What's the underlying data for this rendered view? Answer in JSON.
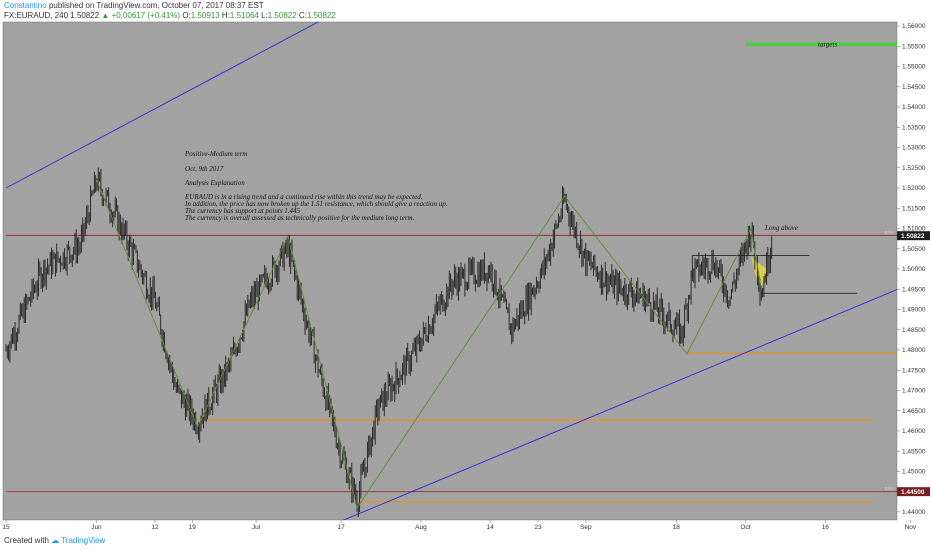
{
  "header": {
    "author": "Constantino",
    "published": "published on TradingView.com, October 07, 2017 08:37 EST",
    "symbol": "FX:EURAUD, 240",
    "last": "1.50822",
    "change": "+0.00617 (+0.41%)",
    "o_label": "O:",
    "o_value": "1.50913",
    "h_label": "H:",
    "h_value": "1.51064",
    "l_label": "L:",
    "l_value": "1.50822",
    "c_label": "C:",
    "c_value": "1.50822"
  },
  "footer": {
    "created_with": "Created with",
    "brand": "TradingView"
  },
  "colors": {
    "background": "#a2a2a2",
    "candle": "#1f1f1f",
    "channel": "#2b2bd6",
    "zigzag": "#5f8a3e",
    "support": "#e0922e",
    "resistance": "#9e2a2a",
    "target": "#55c84a",
    "panel": "#ffffff"
  },
  "annotation": {
    "lines": [
      "Positive-Medium term",
      "Oct, 9th  2017",
      "Analysis Explanation",
      "EURAUD is in a rising trend and a continued rise within this trend may be expected.",
      "In addition, the price has now broken up the 1.51 resistance, which should give a reaction up.",
      "The currency has support at points 1.445",
      "The currency is overall assessed as technically positive for the medium long term."
    ],
    "targets_label": "targets",
    "long_label": "Long above",
    "price_tag_upper": "1.50822",
    "price_tag_lower": "1.44500",
    "small_tag": "ESA"
  },
  "chart_data": {
    "type": "line",
    "title": "",
    "series_name": "",
    "y_ticks": [
      "1.56000",
      "1.55500",
      "1.55000",
      "1.54500",
      "1.54000",
      "1.53500",
      "1.53000",
      "1.52500",
      "1.52000",
      "1.51500",
      "1.51000",
      "1.50500",
      "1.50000",
      "1.49500",
      "1.49000",
      "1.48500",
      "1.48000",
      "1.47500",
      "1.47000",
      "1.46500",
      "1.46000",
      "1.45500",
      "1.45000",
      "1.44500",
      "1.44000"
    ],
    "x_ticks": [
      "15",
      "Jun",
      "12",
      "19",
      "Jul",
      "17",
      "Aug",
      "14",
      "23",
      "Sep",
      "18",
      "Oct",
      "16",
      "Nov",
      "13"
    ],
    "ylim": [
      1.438,
      1.561
    ],
    "price_path": [
      {
        "x": "May 15",
        "y": 1.48
      },
      {
        "x": "May 22",
        "y": 1.5
      },
      {
        "x": "May 29",
        "y": 1.506
      },
      {
        "x": "Jun 1",
        "y": 1.522
      },
      {
        "x": "Jun 5",
        "y": 1.512
      },
      {
        "x": "Jun 12",
        "y": 1.492
      },
      {
        "x": "Jun 16",
        "y": 1.47
      },
      {
        "x": "Jun 20",
        "y": 1.462
      },
      {
        "x": "Jun 26",
        "y": 1.476
      },
      {
        "x": "Jun 30",
        "y": 1.492
      },
      {
        "x": "Jul 7",
        "y": 1.505
      },
      {
        "x": "Jul 13",
        "y": 1.474
      },
      {
        "x": "Jul 17",
        "y": 1.454
      },
      {
        "x": "Jul 20",
        "y": 1.443
      },
      {
        "x": "Jul 24",
        "y": 1.466
      },
      {
        "x": "Jul 31",
        "y": 1.48
      },
      {
        "x": "Aug 7",
        "y": 1.497
      },
      {
        "x": "Aug 14",
        "y": 1.5
      },
      {
        "x": "Aug 18",
        "y": 1.485
      },
      {
        "x": "Aug 24",
        "y": 1.5
      },
      {
        "x": "Aug 28",
        "y": 1.517
      },
      {
        "x": "Sep 1",
        "y": 1.502
      },
      {
        "x": "Sep 6",
        "y": 1.496
      },
      {
        "x": "Sep 12",
        "y": 1.493
      },
      {
        "x": "Sep 19",
        "y": 1.484
      },
      {
        "x": "Sep 21",
        "y": 1.499
      },
      {
        "x": "Sep 25",
        "y": 1.502
      },
      {
        "x": "Sep 28",
        "y": 1.493
      },
      {
        "x": "Oct 2",
        "y": 1.51
      },
      {
        "x": "Oct 4",
        "y": 1.494
      },
      {
        "x": "Oct 6",
        "y": 1.5082
      }
    ],
    "zigzag": [
      {
        "x": "Jun 1",
        "y": 1.522
      },
      {
        "x": "Jun 20",
        "y": 1.461
      },
      {
        "x": "Jul 7",
        "y": 1.508
      },
      {
        "x": "Jul 20",
        "y": 1.441
      },
      {
        "x": "Aug 28",
        "y": 1.518
      },
      {
        "x": "Sep 20",
        "y": 1.479
      },
      {
        "x": "Oct 2",
        "y": 1.51
      },
      {
        "x": "Oct 4",
        "y": 1.495
      }
    ],
    "channel_upper": [
      {
        "x": "May 15",
        "y": 1.52
      },
      {
        "x": "Aug 16",
        "y": 1.585
      }
    ],
    "channel_lower": [
      {
        "x": "Jul 12",
        "y": 1.435
      },
      {
        "x": "Nov 16",
        "y": 1.5045
      }
    ],
    "levels": [
      {
        "name": "resistance 1.51",
        "y": 1.5083,
        "from": "May 15",
        "to": "Nov 16"
      },
      {
        "name": "support 1.445",
        "y": 1.445,
        "from": "May 15",
        "to": "Nov 16"
      },
      {
        "name": "support",
        "y": 1.4792,
        "from": "Sep 20",
        "to": "Oct 30"
      },
      {
        "name": "support",
        "y": 1.4627,
        "from": "Jun 20",
        "to": "Oct 25"
      },
      {
        "name": "support",
        "y": 1.4425,
        "from": "Jul 20",
        "to": "Oct 25"
      },
      {
        "name": "targets",
        "y": 1.5555,
        "from": "Oct 1",
        "to": "Nov 16"
      },
      {
        "name": "box top",
        "y": 1.5033,
        "from": "Sep 21",
        "to": "Oct 13"
      },
      {
        "name": "box bottom",
        "y": 1.494,
        "from": "Oct 4",
        "to": "Oct 22"
      }
    ]
  }
}
